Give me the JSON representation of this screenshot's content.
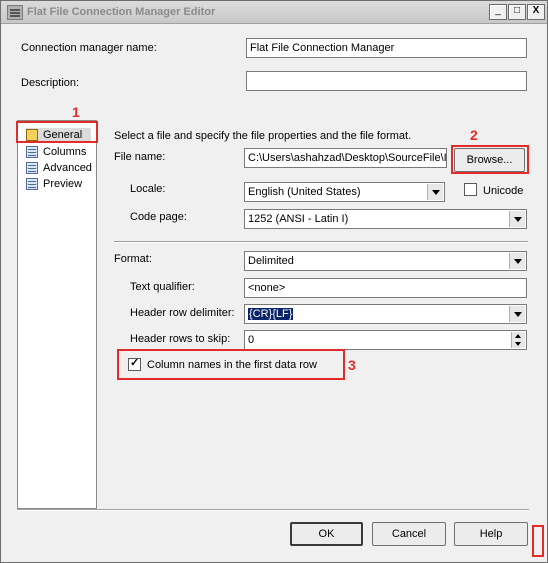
{
  "window": {
    "title": "Flat File Connection Manager Editor",
    "min": "_",
    "max": "□",
    "close": "X"
  },
  "top": {
    "cm_name_label": "Connection manager name:",
    "cm_name_value": "Flat File Connection Manager",
    "description_label": "Description:",
    "description_value": ""
  },
  "nav": {
    "items": [
      {
        "label": "General"
      },
      {
        "label": "Columns"
      },
      {
        "label": "Advanced"
      },
      {
        "label": "Preview"
      }
    ]
  },
  "general": {
    "instructions": "Select a file and specify the file properties and the file format.",
    "file_name_label": "File name:",
    "file_name_value": "C:\\Users\\ashahzad\\Desktop\\SourceFile\\In",
    "browse_label": "Browse...",
    "locale_label": "Locale:",
    "locale_value": "English (United States)",
    "unicode_label": "Unicode",
    "code_page_label": "Code page:",
    "code_page_value": "1252  (ANSI - Latin I)",
    "format_label": "Format:",
    "format_value": "Delimited",
    "text_qualifier_label": "Text qualifier:",
    "text_qualifier_value": "<none>",
    "header_row_delimiter_label": "Header row delimiter:",
    "header_row_delimiter_value": "{CR}{LF}",
    "header_rows_skip_label": "Header rows to skip:",
    "header_rows_skip_value": "0",
    "column_names_label": "Column names in the first data row"
  },
  "annotations": {
    "n1": "1",
    "n2": "2",
    "n3": "3"
  },
  "buttons": {
    "ok": "OK",
    "cancel": "Cancel",
    "help": "Help"
  },
  "colors": {
    "annotation_red": "#e32b2b",
    "selection": "#0a246a"
  }
}
